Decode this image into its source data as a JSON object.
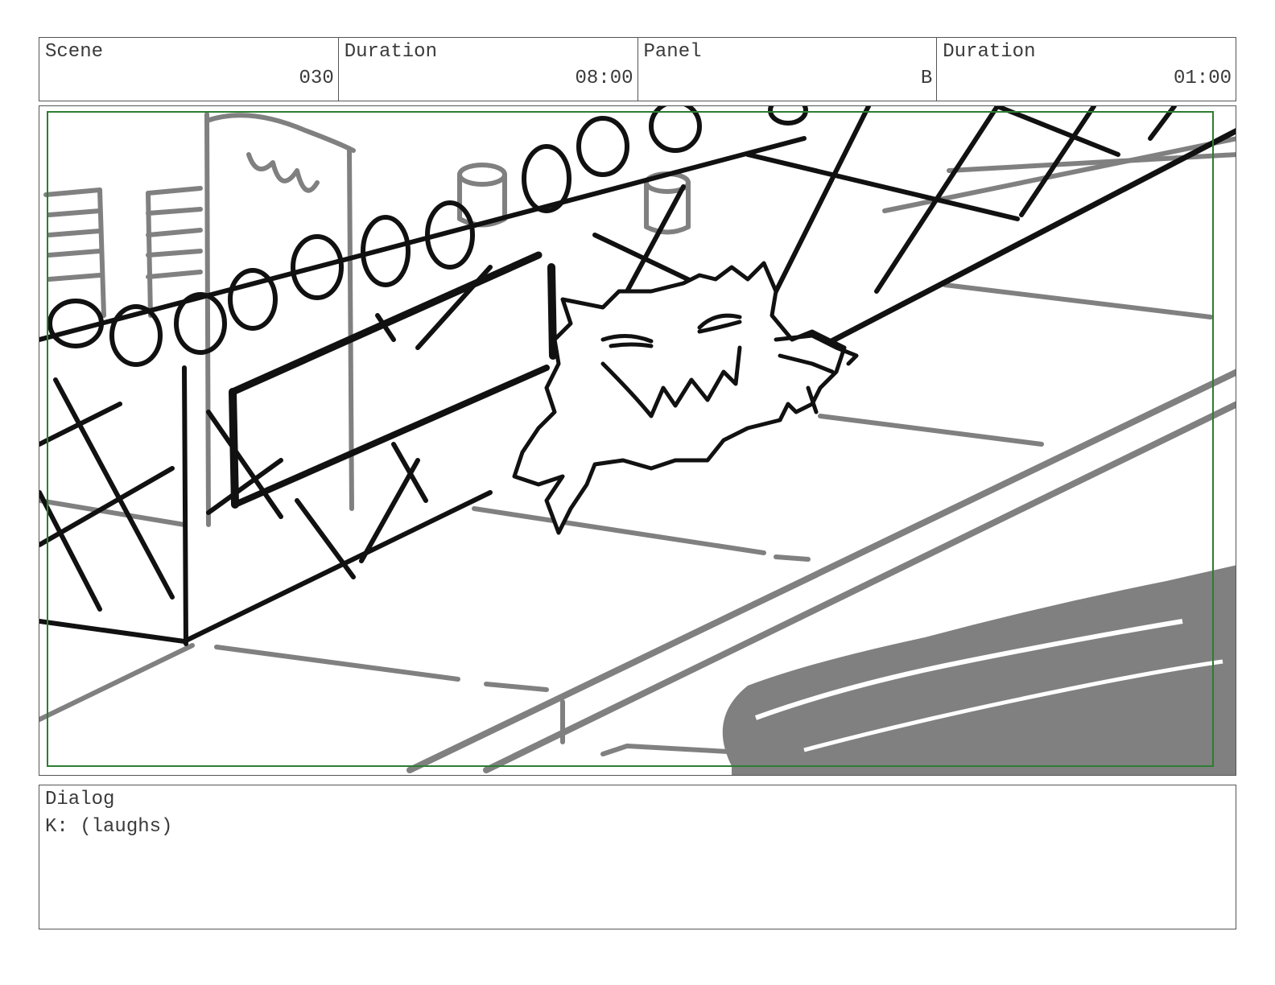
{
  "header": {
    "scene_label": "Scene",
    "scene_value": "030",
    "scene_duration_label": "Duration",
    "scene_duration_value": "08:00",
    "panel_label": "Panel",
    "panel_value": "B",
    "panel_duration_label": "Duration",
    "panel_duration_value": "01:00"
  },
  "dialog": {
    "label": "Dialog",
    "text": "K: (laughs)"
  },
  "colors": {
    "ink": "#111111",
    "pencil_gray": "#808080",
    "safe_frame_green": "#2e7d32",
    "border": "#555555"
  }
}
